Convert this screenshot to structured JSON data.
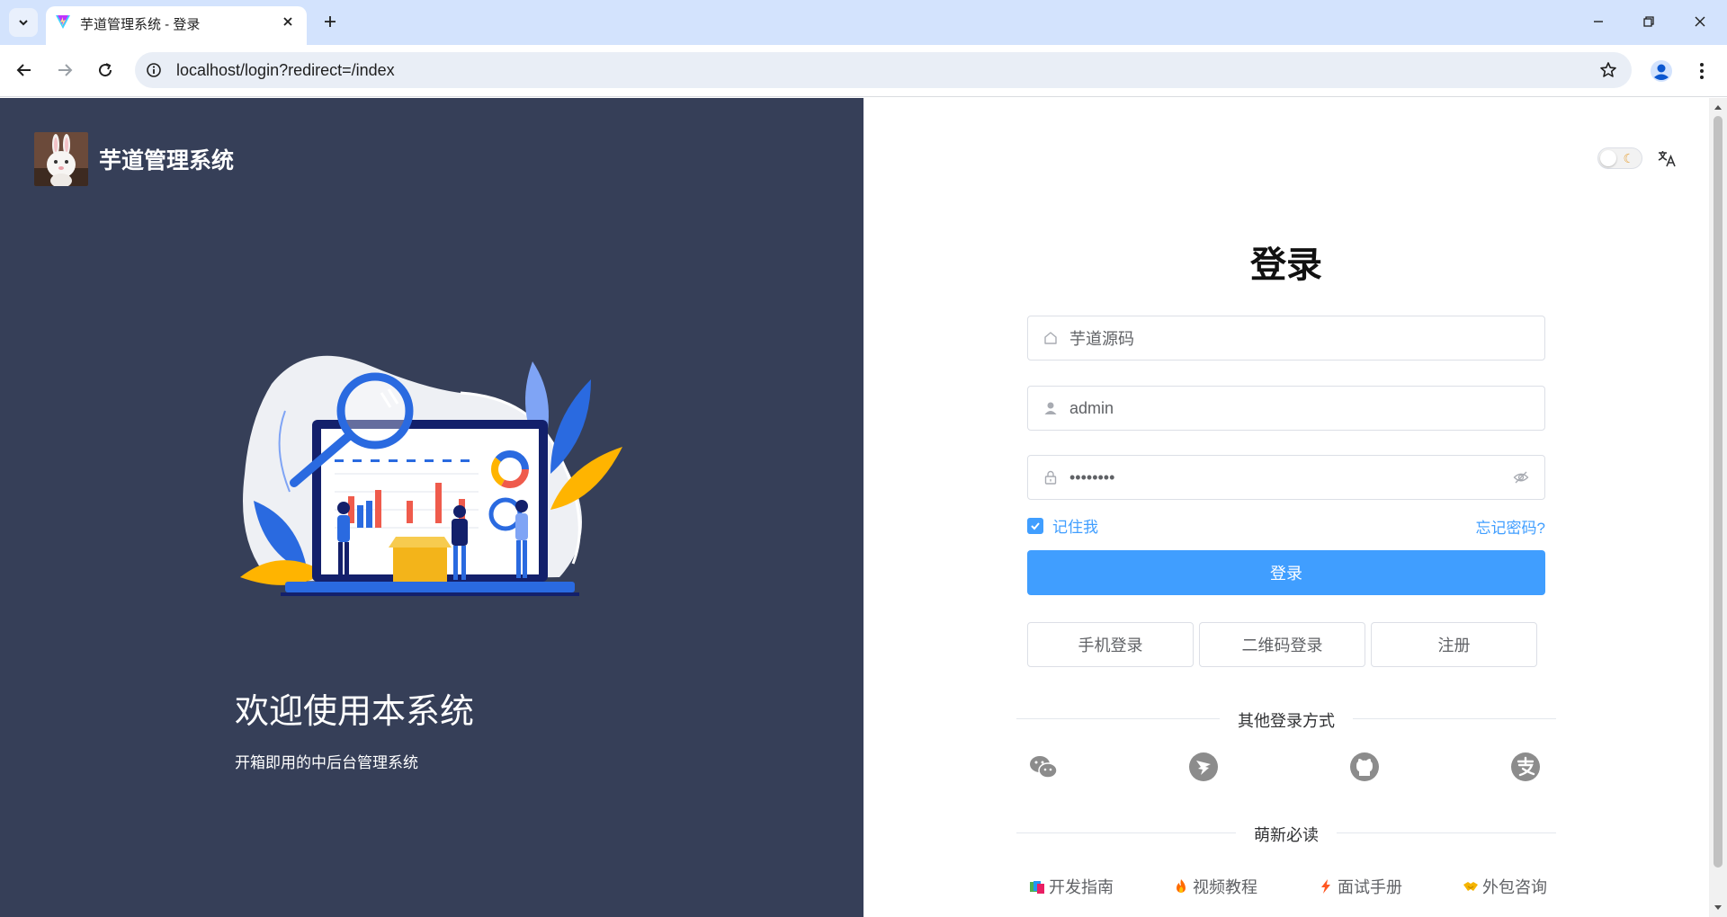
{
  "browser": {
    "tab_title": "芋道管理系统 - 登录",
    "url": "localhost/login?redirect=/index"
  },
  "brand": {
    "title": "芋道管理系统"
  },
  "hero": {
    "welcome": "欢迎使用本系统",
    "subtitle": "开箱即用的中后台管理系统"
  },
  "login": {
    "title": "登录",
    "tenant_value": "芋道源码",
    "username_value": "admin",
    "password_value": "••••••••",
    "remember_label": "记住我",
    "remember_checked": true,
    "forgot_label": "忘记密码?",
    "submit_label": "登录",
    "alt_buttons": [
      "手机登录",
      "二维码登录",
      "注册"
    ],
    "other_methods_label": "其他登录方式",
    "social_icons": [
      "wechat-icon",
      "dingtalk-icon",
      "github-icon",
      "alipay-icon"
    ],
    "must_read_label": "萌新必读",
    "must_read": [
      {
        "label": "开发指南",
        "icon": "book-icon"
      },
      {
        "label": "视频教程",
        "icon": "fire-icon"
      },
      {
        "label": "面试手册",
        "icon": "lightning-icon"
      },
      {
        "label": "外包咨询",
        "icon": "handshake-icon"
      }
    ]
  },
  "colors": {
    "primary": "#409eff",
    "left_panel_bg": "#363f58",
    "tabstrip_bg": "#d3e3fd"
  }
}
